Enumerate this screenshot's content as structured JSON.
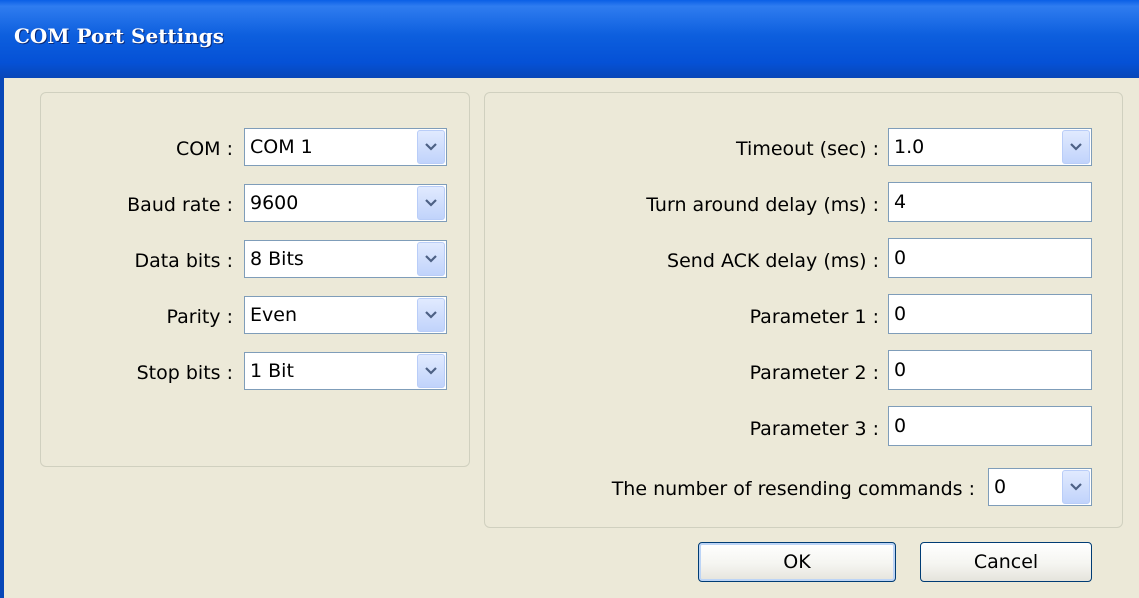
{
  "window": {
    "title": "COM Port Settings"
  },
  "serial": {
    "com": {
      "label": "COM :",
      "value": "COM 1"
    },
    "baud": {
      "label": "Baud rate :",
      "value": "9600"
    },
    "data_bits": {
      "label": "Data bits :",
      "value": "8 Bits"
    },
    "parity": {
      "label": "Parity :",
      "value": "Even"
    },
    "stop_bits": {
      "label": "Stop bits :",
      "value": "1 Bit"
    }
  },
  "protocol": {
    "timeout": {
      "label": "Timeout (sec) :",
      "value": "1.0"
    },
    "turn_around": {
      "label": "Turn around delay (ms) :",
      "value": "4"
    },
    "send_ack": {
      "label": "Send ACK delay (ms) :",
      "value": "0"
    },
    "param1": {
      "label": "Parameter 1 :",
      "value": "0"
    },
    "param2": {
      "label": "Parameter 2 :",
      "value": "0"
    },
    "param3": {
      "label": "Parameter 3 :",
      "value": "0"
    },
    "resend": {
      "label": "The number of resending commands :",
      "value": "0"
    }
  },
  "buttons": {
    "ok": "OK",
    "cancel": "Cancel"
  },
  "icons": {
    "dropdown": "chevron-down-icon"
  },
  "colors": {
    "titlebar": "#0551d6",
    "dialog_bg": "#ece9d8",
    "field_border": "#7f9db9"
  }
}
